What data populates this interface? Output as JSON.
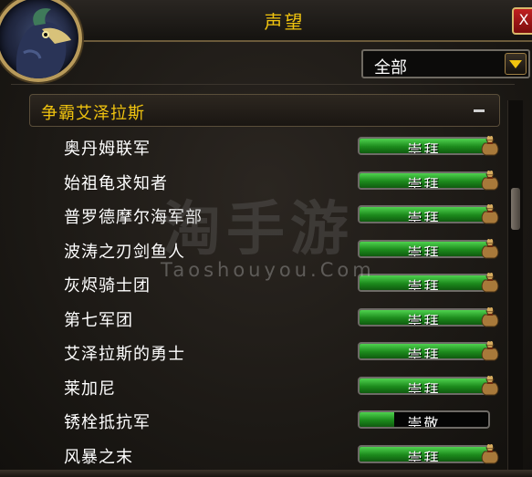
{
  "window": {
    "title": "声望",
    "close_label": "X"
  },
  "filter": {
    "selected": "全部"
  },
  "category": {
    "label": "争霸艾泽拉斯",
    "collapse_symbol": "–"
  },
  "factions": [
    {
      "name": "奥丹姆联军",
      "standing": "崇拜",
      "progress": 1.0,
      "reward": true
    },
    {
      "name": "始祖龟求知者",
      "standing": "崇拜",
      "progress": 1.0,
      "reward": true
    },
    {
      "name": "普罗德摩尔海军部",
      "standing": "崇拜",
      "progress": 1.0,
      "reward": true
    },
    {
      "name": "波涛之刃剑鱼人",
      "standing": "崇拜",
      "progress": 1.0,
      "reward": true
    },
    {
      "name": "灰烬骑士团",
      "standing": "崇拜",
      "progress": 1.0,
      "reward": true
    },
    {
      "name": "第七军团",
      "standing": "崇拜",
      "progress": 1.0,
      "reward": true
    },
    {
      "name": "艾泽拉斯的勇士",
      "standing": "崇拜",
      "progress": 1.0,
      "reward": true
    },
    {
      "name": "莱加尼",
      "standing": "崇拜",
      "progress": 1.0,
      "reward": true
    },
    {
      "name": "锈栓抵抗军",
      "standing": "崇敬",
      "progress": 0.27,
      "reward": false
    },
    {
      "name": "风暴之末",
      "standing": "崇拜",
      "progress": 1.0,
      "reward": true
    }
  ],
  "watermark": {
    "main": "淘手游",
    "sub": "Taoshouyou.Com"
  },
  "colors": {
    "title_gold": "#f1c40f",
    "bar_green": "#1c8a1c"
  },
  "icons": {
    "reward": "paragon-bag-icon",
    "portrait": "character-portrait",
    "dropdown": "chevron-down-icon"
  }
}
